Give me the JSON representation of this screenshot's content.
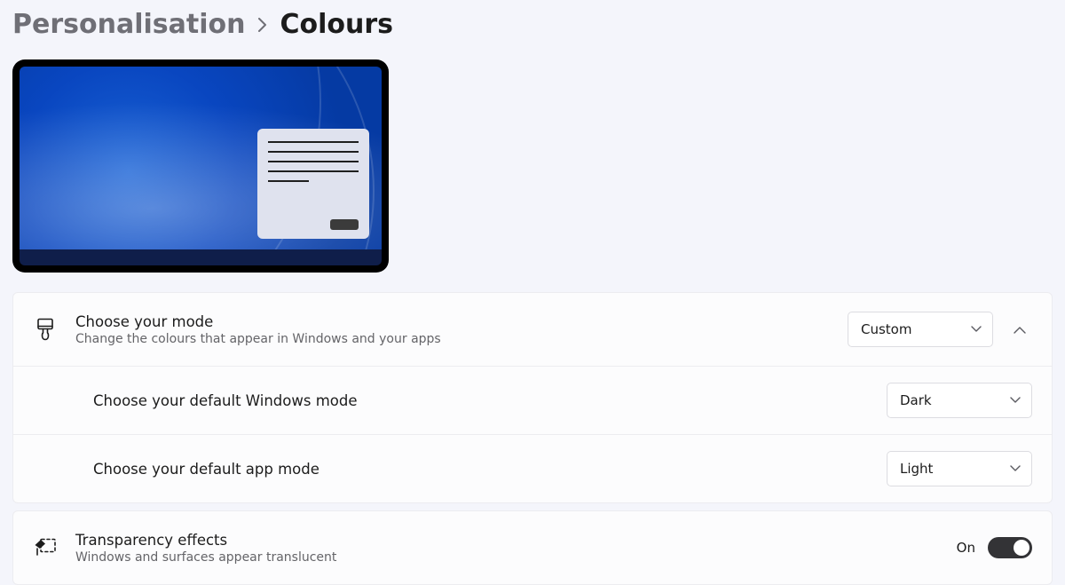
{
  "breadcrumb": {
    "parent": "Personalisation",
    "current": "Colours"
  },
  "mode": {
    "title": "Choose your mode",
    "description": "Change the colours that appear in Windows and your apps",
    "value": "Custom",
    "expanded": true,
    "windows_mode": {
      "title": "Choose your default Windows mode",
      "value": "Dark"
    },
    "app_mode": {
      "title": "Choose your default app mode",
      "value": "Light"
    }
  },
  "transparency": {
    "title": "Transparency effects",
    "description": "Windows and surfaces appear translucent",
    "state_label": "On",
    "enabled": true
  }
}
